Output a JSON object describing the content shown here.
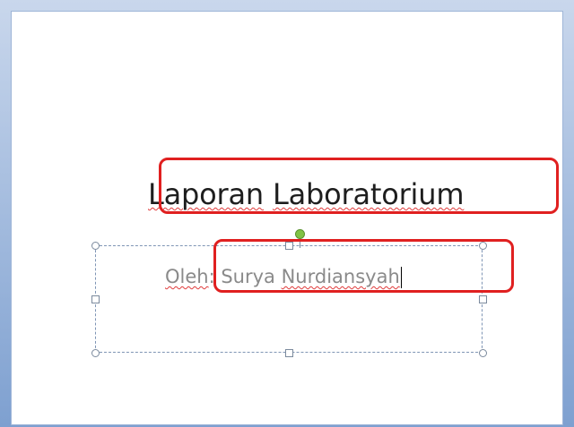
{
  "slide": {
    "title": {
      "word1": "Laporan",
      "space": " ",
      "word2": "Laboratorium"
    },
    "subtitle": {
      "prefix": "Oleh",
      "middle": ": Surya ",
      "name": "Nurdiansyah"
    }
  },
  "annotations": {
    "highlight_color": "#e02020"
  }
}
